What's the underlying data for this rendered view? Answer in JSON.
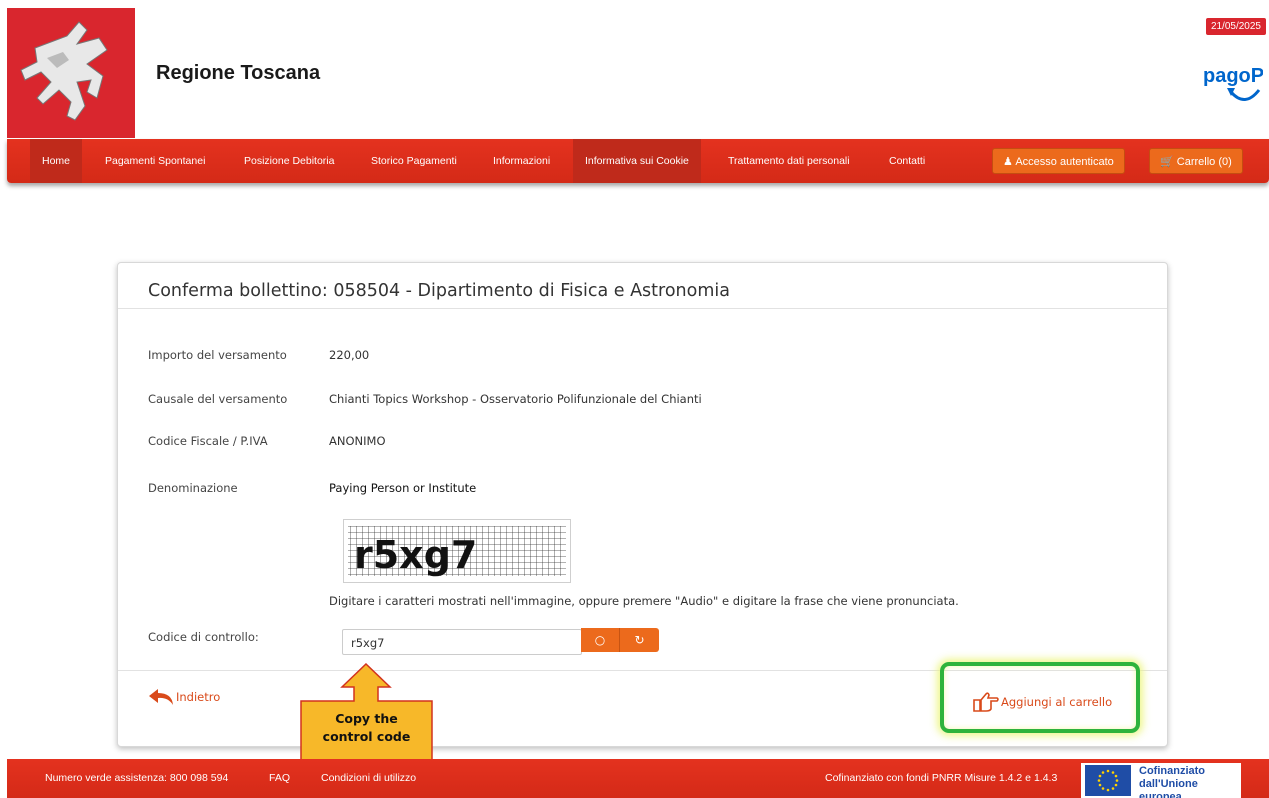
{
  "header": {
    "brand": "Regione Toscana",
    "date": "21/05/2025",
    "pagopa_logo": "pagoPA"
  },
  "nav": {
    "items": [
      "Home",
      "Pagamenti Spontanei",
      "Posizione Debitoria",
      "Storico Pagamenti",
      "Informazioni",
      "Informativa sui Cookie",
      "Trattamento dati personali",
      "Contatti"
    ],
    "login_button": "Accesso autenticato",
    "cart_button": "Carrello (0)"
  },
  "panel": {
    "title": "Conferma bollettino: 058504 - Dipartimento di Fisica e Astronomia",
    "rows": [
      {
        "label": "Importo del versamento",
        "value": "220,00"
      },
      {
        "label": "Causale del versamento",
        "value": "Chianti Topics Workshop - Osservatorio Polifunzionale del Chianti"
      },
      {
        "label": "Codice Fiscale / P.IVA",
        "value": "ANONIMO"
      },
      {
        "label": "Denominazione",
        "value": "Paying Person or Institute"
      }
    ],
    "captcha_text": "r5xg7",
    "captcha_hint": "Digitare i caratteri mostrati nell'immagine, oppure premere \"Audio\" e digitare la frase che viene pronunciata.",
    "control_label": "Codice di controllo:",
    "control_value": "r5xg7",
    "back_label": "Indietro",
    "add_cart_label": "Aggiungi al carrello"
  },
  "callout": {
    "line1": "Copy the",
    "line2": "control code"
  },
  "footer": {
    "helpline": "Numero verde assistenza: 800 098 594",
    "faq": "FAQ",
    "terms": "Condizioni di utilizzo",
    "funding": "Cofinanziato con fondi PNRR Misure 1.4.2 e 1.4.3",
    "eu_line1": "Cofinanziato",
    "eu_line2": "dall'Unione europea"
  },
  "colors": {
    "brand_red": "#d9262e",
    "nav_red": "#e4321f",
    "button_orange": "#ec6a1c",
    "highlight_green": "#2eb33c",
    "callout_yellow": "#f7b829"
  }
}
